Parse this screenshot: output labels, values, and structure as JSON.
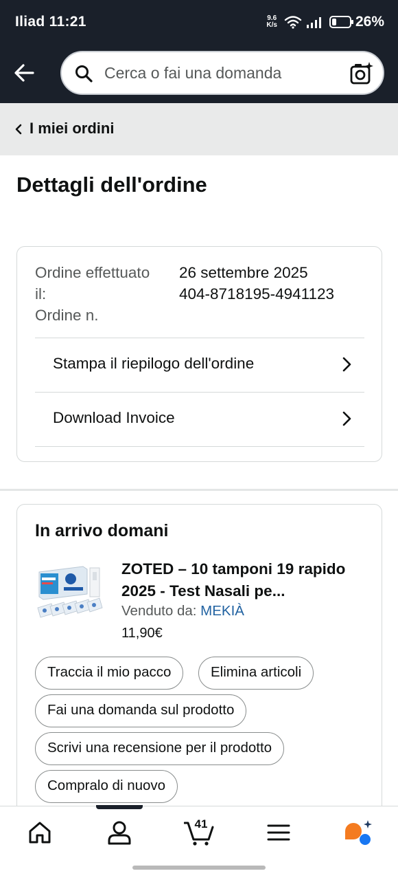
{
  "status_bar": {
    "carrier": "Iliad",
    "time": "11:21",
    "net_speed_value": "9.6",
    "net_speed_unit": "K/s",
    "battery": "26%",
    "battery_level": 0.26
  },
  "header": {
    "search_placeholder": "Cerca o fai una domanda"
  },
  "breadcrumb": {
    "label": "I miei ordini"
  },
  "page": {
    "title": "Dettagli dell'ordine"
  },
  "order_info": {
    "label_date": "Ordine effettuato il:",
    "label_number": "Ordine n.",
    "date": "26 settembre 2025",
    "number": "404-8718195-4941123",
    "print_summary": "Stampa il riepilogo dell'ordine",
    "download_invoice": "Download Invoice"
  },
  "delivery": {
    "title": "In arrivo domani",
    "product": {
      "title": "ZOTED – 10 tamponi 19 rapido 2025 - Test Nasali pe...",
      "seller_prefix": "Venduto da:",
      "seller_name": "MEKIÀ",
      "price": "11,90€"
    },
    "actions": {
      "track": "Traccia il mio pacco",
      "delete": "Elimina articoli",
      "ask": "Fai una domanda sul prodotto",
      "review": "Scrivi una recensione per il prodotto",
      "buy_again": "Compralo di nuovo"
    }
  },
  "bottom_nav": {
    "cart_count": "41"
  },
  "colors": {
    "header_bg": "#1a202a",
    "link": "#2162a1",
    "assistant_orange": "#f47b20",
    "assistant_blue": "#1877f2"
  }
}
